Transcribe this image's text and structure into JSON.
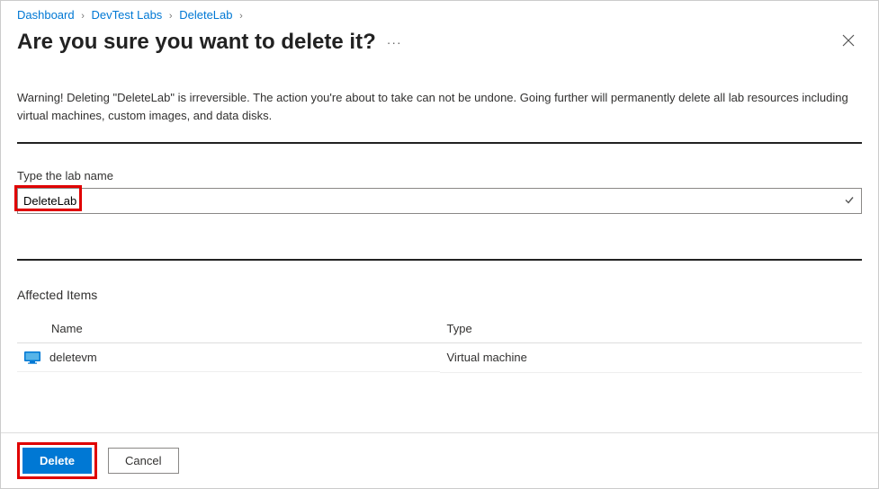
{
  "breadcrumb": {
    "items": [
      "Dashboard",
      "DevTest Labs",
      "DeleteLab"
    ]
  },
  "header": {
    "title": "Are you sure you want to delete it?"
  },
  "warning": "Warning! Deleting \"DeleteLab\" is irreversible. The action you're about to take can not be undone. Going further will permanently delete all lab resources including virtual machines, custom images, and data disks.",
  "form": {
    "label": "Type the lab name",
    "value": "DeleteLab"
  },
  "affected": {
    "heading": "Affected Items",
    "columns": {
      "name": "Name",
      "type": "Type"
    },
    "rows": [
      {
        "name": "deletevm",
        "type": "Virtual machine"
      }
    ]
  },
  "footer": {
    "delete": "Delete",
    "cancel": "Cancel"
  }
}
